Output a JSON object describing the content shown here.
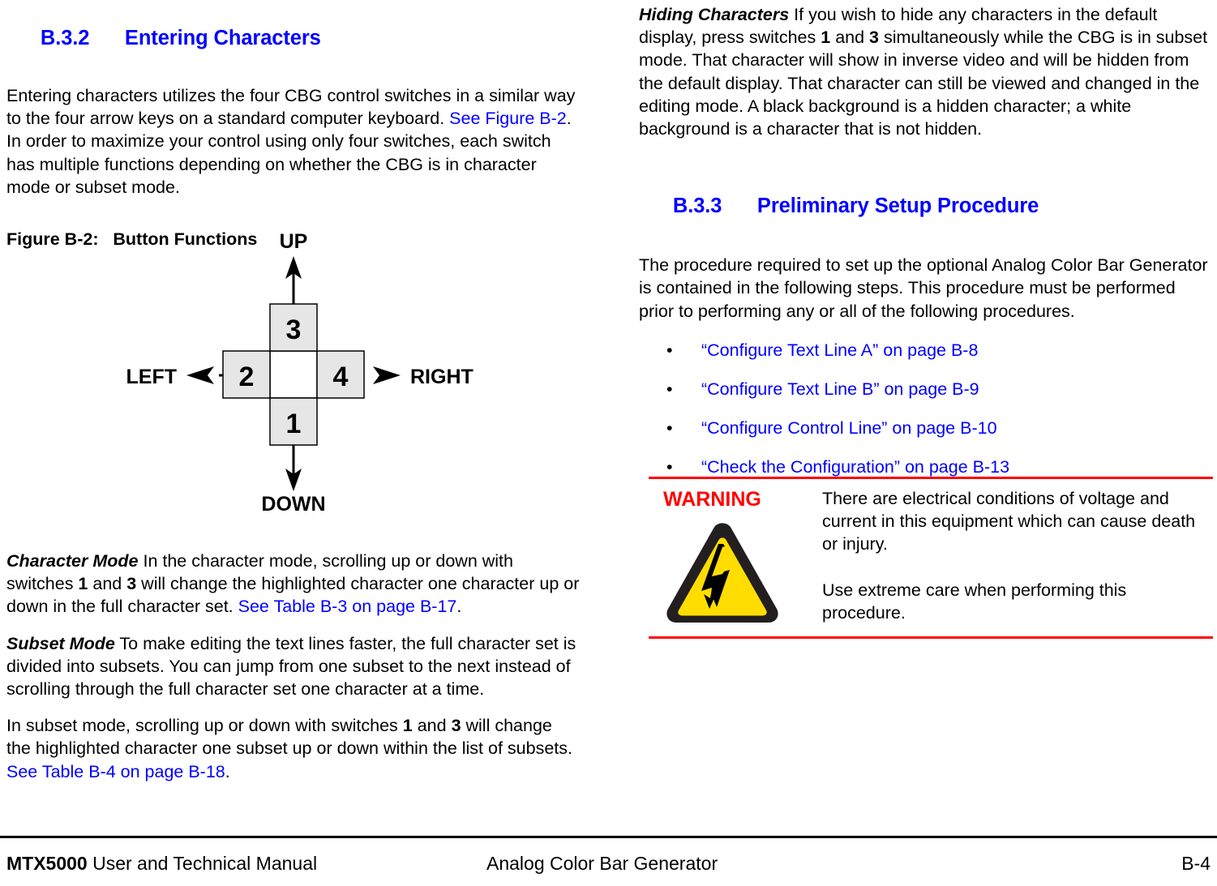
{
  "document": {
    "page_number": "B-4",
    "footer_left_bold": "MTX5000",
    "footer_left_rest": " User and Technical Manual",
    "footer_center": "Analog Color Bar Generator",
    "footer_right": "B-4"
  },
  "colors": {
    "heading_blue": "#0000FF",
    "link_blue": "#0000FF",
    "warning_red": "#FF0000",
    "hazard_yellow": "#FFDD00",
    "hazard_dark": "#231F20",
    "box_fill": "#E6E6E6",
    "text_black": "#000000"
  },
  "left_column": {
    "heading": {
      "number": "B.3.2",
      "title": "Entering Characters"
    },
    "intro_paragraph": {
      "part1": "Entering characters utilizes the four CBG control switches in a similar way to the four arrow keys on a standard computer keyboard.  ",
      "link": "See Figure B-2",
      "part2": ".  In order to maximize your control using only four switches, each switch has multiple functions depending on whether the CBG is in character mode or subset mode."
    },
    "figure_caption": "Figure B-2:   Button Functions",
    "figure": {
      "labels": {
        "up": "UP",
        "down": "DOWN",
        "left": "LEFT",
        "right": "RIGHT"
      },
      "buttons": {
        "top": "3",
        "bottom": "1",
        "left": "2",
        "right": "4"
      }
    },
    "character_mode": {
      "run_in": "Character Mode",
      "part1": "  In the character mode, scrolling up or down with switches ",
      "b1": "1",
      "part2": " and ",
      "b2": "3",
      "part3": " will change the highlighted character one character up or down in the full character set.  ",
      "link": "See Table B-3 on page B-17",
      "part4": "."
    },
    "subset_mode": {
      "run_in": "Subset Mode",
      "text": "  To make editing the text lines faster, the full character set is divided into subsets.  You can jump from one subset to the next instead of scrolling through the full character set one character at a time."
    },
    "subset_scroll": {
      "part1": "In subset mode, scrolling up or down with switches ",
      "b1": "1",
      "part2": " and ",
      "b2": "3",
      "part3": " will change the highlighted character one subset up or down within the list of subsets.  ",
      "link": "See Table B-4 on page B-18",
      "part4": "."
    }
  },
  "right_column": {
    "hiding_characters": {
      "run_in": "Hiding Characters",
      "part1": "  If you wish to hide any characters in the default display, press switches ",
      "b1": "1",
      "part2": " and ",
      "b2": "3",
      "part3": " simultaneously while the CBG is in subset mode.  That character will show in inverse video and will be hidden from the default display.  That character can still be viewed and changed in the editing mode.  A black background is a hidden character; a white background is a character that is not hidden."
    },
    "heading": {
      "number": "B.3.3",
      "title": "Preliminary Setup Procedure"
    },
    "procedure_paragraph": "The procedure required to set up the optional Analog Color Bar Generator is contained in the following steps.  This procedure must be performed prior to performing any or all of the following procedures.",
    "bullets": [
      "“Configure Text Line A” on page B-8",
      "“Configure Text Line B” on page B-9",
      "“Configure Control Line” on page B-10",
      "“Check the Configuration” on page B-13"
    ],
    "warning": {
      "label": "WARNING",
      "paragraph1": "There are electrical conditions of voltage and current in this equipment which can cause death or injury.",
      "paragraph2": "Use extreme care when performing this procedure."
    }
  }
}
